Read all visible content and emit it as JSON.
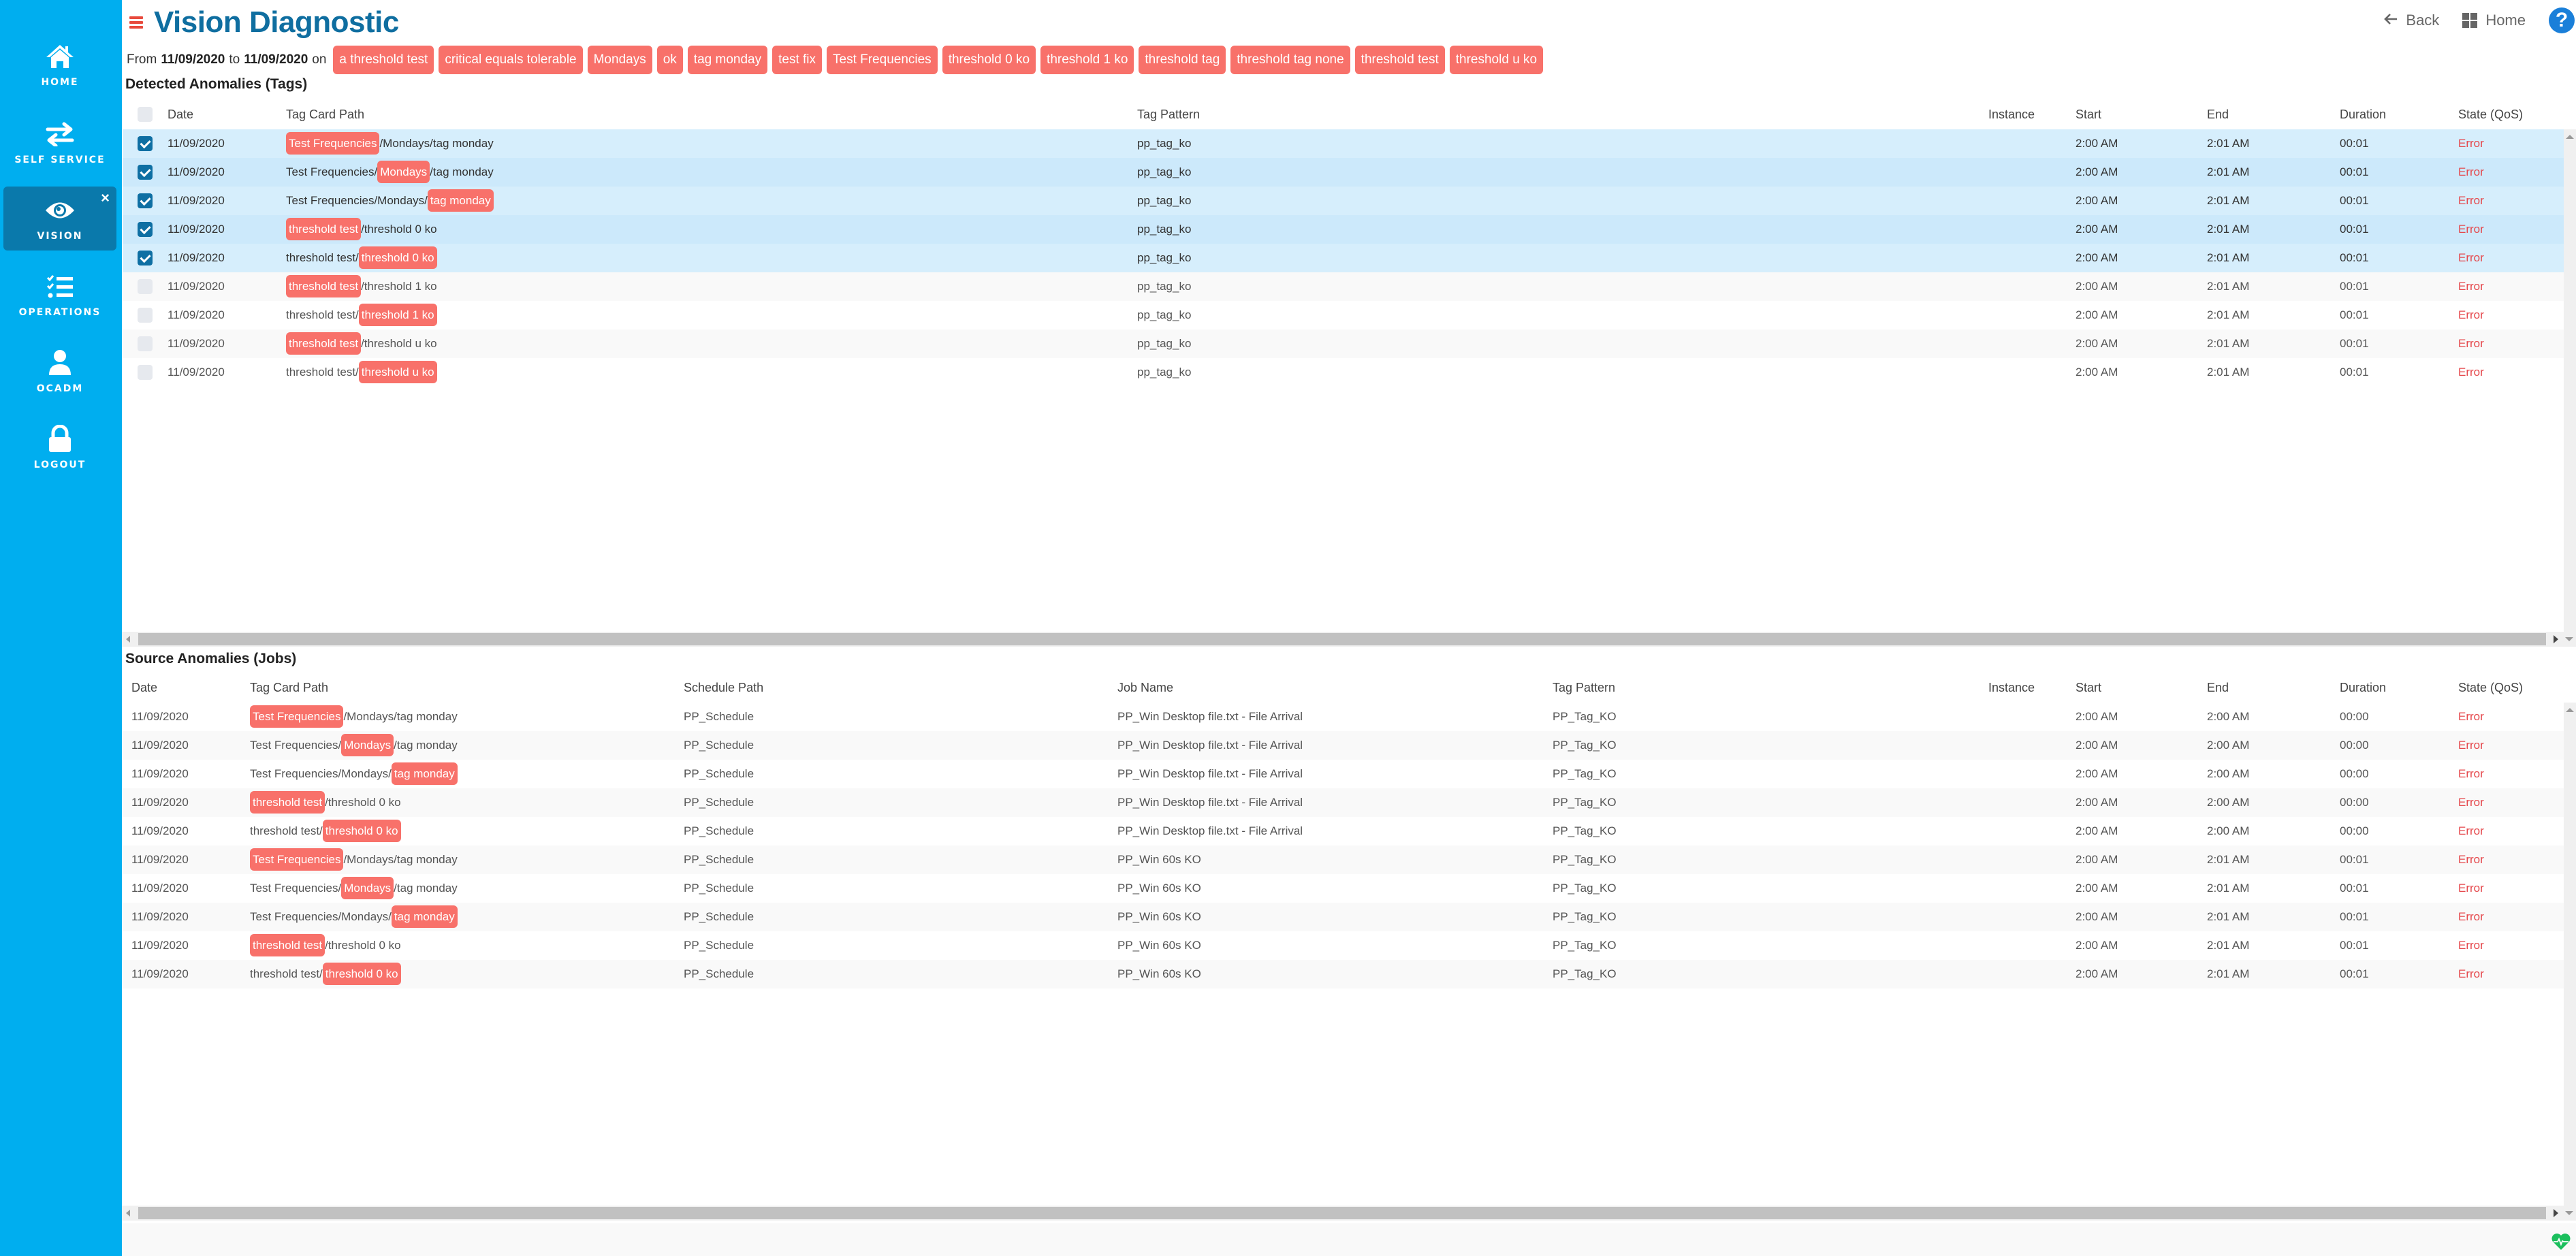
{
  "sidebar": {
    "items": [
      {
        "label": "HOME",
        "icon": "home-icon"
      },
      {
        "label": "SELF SERVICE",
        "icon": "swap-arrows-icon"
      },
      {
        "label": "VISION",
        "icon": "eye-icon",
        "active": true,
        "close": "×"
      },
      {
        "label": "OPERATIONS",
        "icon": "task-list-icon"
      },
      {
        "label": "OCADM",
        "icon": "user-icon"
      },
      {
        "label": "LOGOUT",
        "icon": "lock-icon"
      }
    ]
  },
  "header": {
    "title": "Vision Diagnostic",
    "back_label": "Back",
    "home_label": "Home",
    "help_label": "?"
  },
  "filter": {
    "from_label": "From",
    "from_date": "11/09/2020",
    "to_label": "to",
    "to_date": "11/09/2020",
    "on_label": "on",
    "tags": [
      "a threshold test",
      "critical equals tolerable",
      "Mondays",
      "ok",
      "tag monday",
      "test fix",
      "Test Frequencies",
      "threshold 0 ko",
      "threshold 1 ko",
      "threshold tag",
      "threshold tag none",
      "threshold test",
      "threshold u ko"
    ]
  },
  "tags_table": {
    "title": "Detected Anomalies (Tags)",
    "columns": {
      "date": "Date",
      "path": "Tag Card Path",
      "pattern": "Tag Pattern",
      "instance": "Instance",
      "start": "Start",
      "end": "End",
      "duration": "Duration",
      "state": "State (QoS)"
    },
    "rows": [
      {
        "checked": true,
        "date": "11/09/2020",
        "path": {
          "pre": "",
          "hl": "Test Frequencies",
          "post": "/Mondays/tag monday"
        },
        "pattern": "pp_tag_ko",
        "instance": "",
        "start": "2:00 AM",
        "end": "2:01 AM",
        "duration": "00:01",
        "state": "Error"
      },
      {
        "checked": true,
        "date": "11/09/2020",
        "path": {
          "pre": "Test Frequencies/",
          "hl": "Mondays",
          "post": "/tag monday"
        },
        "pattern": "pp_tag_ko",
        "instance": "",
        "start": "2:00 AM",
        "end": "2:01 AM",
        "duration": "00:01",
        "state": "Error"
      },
      {
        "checked": true,
        "date": "11/09/2020",
        "path": {
          "pre": "Test Frequencies/Mondays/",
          "hl": "tag monday",
          "post": ""
        },
        "pattern": "pp_tag_ko",
        "instance": "",
        "start": "2:00 AM",
        "end": "2:01 AM",
        "duration": "00:01",
        "state": "Error"
      },
      {
        "checked": true,
        "date": "11/09/2020",
        "path": {
          "pre": "",
          "hl": "threshold test",
          "post": "/threshold 0 ko"
        },
        "pattern": "pp_tag_ko",
        "instance": "",
        "start": "2:00 AM",
        "end": "2:01 AM",
        "duration": "00:01",
        "state": "Error"
      },
      {
        "checked": true,
        "date": "11/09/2020",
        "path": {
          "pre": "threshold test/",
          "hl": "threshold 0 ko",
          "post": ""
        },
        "pattern": "pp_tag_ko",
        "instance": "",
        "start": "2:00 AM",
        "end": "2:01 AM",
        "duration": "00:01",
        "state": "Error"
      },
      {
        "checked": false,
        "date": "11/09/2020",
        "path": {
          "pre": "",
          "hl": "threshold test",
          "post": "/threshold 1 ko"
        },
        "pattern": "pp_tag_ko",
        "instance": "",
        "start": "2:00 AM",
        "end": "2:01 AM",
        "duration": "00:01",
        "state": "Error"
      },
      {
        "checked": false,
        "date": "11/09/2020",
        "path": {
          "pre": "threshold test/",
          "hl": "threshold 1 ko",
          "post": ""
        },
        "pattern": "pp_tag_ko",
        "instance": "",
        "start": "2:00 AM",
        "end": "2:01 AM",
        "duration": "00:01",
        "state": "Error"
      },
      {
        "checked": false,
        "date": "11/09/2020",
        "path": {
          "pre": "",
          "hl": "threshold test",
          "post": "/threshold u ko"
        },
        "pattern": "pp_tag_ko",
        "instance": "",
        "start": "2:00 AM",
        "end": "2:01 AM",
        "duration": "00:01",
        "state": "Error"
      },
      {
        "checked": false,
        "date": "11/09/2020",
        "path": {
          "pre": "threshold test/",
          "hl": "threshold u ko",
          "post": ""
        },
        "pattern": "pp_tag_ko",
        "instance": "",
        "start": "2:00 AM",
        "end": "2:01 AM",
        "duration": "00:01",
        "state": "Error"
      }
    ]
  },
  "jobs_table": {
    "title": "Source Anomalies (Jobs)",
    "columns": {
      "date": "Date",
      "path": "Tag Card Path",
      "schedule": "Schedule Path",
      "job": "Job Name",
      "pattern": "Tag Pattern",
      "instance": "Instance",
      "start": "Start",
      "end": "End",
      "duration": "Duration",
      "state": "State (QoS)"
    },
    "rows": [
      {
        "date": "11/09/2020",
        "path": {
          "pre": "",
          "hl": "Test Frequencies",
          "post": "/Mondays/tag monday"
        },
        "schedule": "PP_Schedule",
        "job": "PP_Win Desktop file.txt - File Arrival",
        "pattern": "PP_Tag_KO",
        "instance": "",
        "start": "2:00 AM",
        "end": "2:00 AM",
        "duration": "00:00",
        "state": "Error"
      },
      {
        "date": "11/09/2020",
        "path": {
          "pre": "Test Frequencies/",
          "hl": "Mondays",
          "post": "/tag monday"
        },
        "schedule": "PP_Schedule",
        "job": "PP_Win Desktop file.txt - File Arrival",
        "pattern": "PP_Tag_KO",
        "instance": "",
        "start": "2:00 AM",
        "end": "2:00 AM",
        "duration": "00:00",
        "state": "Error"
      },
      {
        "date": "11/09/2020",
        "path": {
          "pre": "Test Frequencies/Mondays/",
          "hl": "tag monday",
          "post": ""
        },
        "schedule": "PP_Schedule",
        "job": "PP_Win Desktop file.txt - File Arrival",
        "pattern": "PP_Tag_KO",
        "instance": "",
        "start": "2:00 AM",
        "end": "2:00 AM",
        "duration": "00:00",
        "state": "Error"
      },
      {
        "date": "11/09/2020",
        "path": {
          "pre": "",
          "hl": "threshold test",
          "post": "/threshold 0 ko"
        },
        "schedule": "PP_Schedule",
        "job": "PP_Win Desktop file.txt - File Arrival",
        "pattern": "PP_Tag_KO",
        "instance": "",
        "start": "2:00 AM",
        "end": "2:00 AM",
        "duration": "00:00",
        "state": "Error"
      },
      {
        "date": "11/09/2020",
        "path": {
          "pre": "threshold test/",
          "hl": "threshold 0 ko",
          "post": ""
        },
        "schedule": "PP_Schedule",
        "job": "PP_Win Desktop file.txt - File Arrival",
        "pattern": "PP_Tag_KO",
        "instance": "",
        "start": "2:00 AM",
        "end": "2:00 AM",
        "duration": "00:00",
        "state": "Error"
      },
      {
        "date": "11/09/2020",
        "path": {
          "pre": "",
          "hl": "Test Frequencies",
          "post": "/Mondays/tag monday"
        },
        "schedule": "PP_Schedule",
        "job": "PP_Win 60s KO",
        "pattern": "PP_Tag_KO",
        "instance": "",
        "start": "2:00 AM",
        "end": "2:01 AM",
        "duration": "00:01",
        "state": "Error"
      },
      {
        "date": "11/09/2020",
        "path": {
          "pre": "Test Frequencies/",
          "hl": "Mondays",
          "post": "/tag monday"
        },
        "schedule": "PP_Schedule",
        "job": "PP_Win 60s KO",
        "pattern": "PP_Tag_KO",
        "instance": "",
        "start": "2:00 AM",
        "end": "2:01 AM",
        "duration": "00:01",
        "state": "Error"
      },
      {
        "date": "11/09/2020",
        "path": {
          "pre": "Test Frequencies/Mondays/",
          "hl": "tag monday",
          "post": ""
        },
        "schedule": "PP_Schedule",
        "job": "PP_Win 60s KO",
        "pattern": "PP_Tag_KO",
        "instance": "",
        "start": "2:00 AM",
        "end": "2:01 AM",
        "duration": "00:01",
        "state": "Error"
      },
      {
        "date": "11/09/2020",
        "path": {
          "pre": "",
          "hl": "threshold test",
          "post": "/threshold 0 ko"
        },
        "schedule": "PP_Schedule",
        "job": "PP_Win 60s KO",
        "pattern": "PP_Tag_KO",
        "instance": "",
        "start": "2:00 AM",
        "end": "2:01 AM",
        "duration": "00:01",
        "state": "Error"
      },
      {
        "date": "11/09/2020",
        "path": {
          "pre": "threshold test/",
          "hl": "threshold 0 ko",
          "post": ""
        },
        "schedule": "PP_Schedule",
        "job": "PP_Win 60s KO",
        "pattern": "PP_Tag_KO",
        "instance": "",
        "start": "2:00 AM",
        "end": "2:01 AM",
        "duration": "00:01",
        "state": "Error"
      }
    ]
  },
  "status": {
    "icon": "heartbeat-icon"
  },
  "colors": {
    "sidebar": "#00aeef",
    "sidebar_active": "#0a79ab",
    "title": "#0f6ea0",
    "pill": "#f8716a",
    "error": "#e5474b",
    "checkbox": "#0e6fa3",
    "selected_row_a": "#d6eefc",
    "selected_row_b": "#cce9fb",
    "stripe": "#f9f9f9",
    "heartbeat": "#1bbf5d"
  }
}
